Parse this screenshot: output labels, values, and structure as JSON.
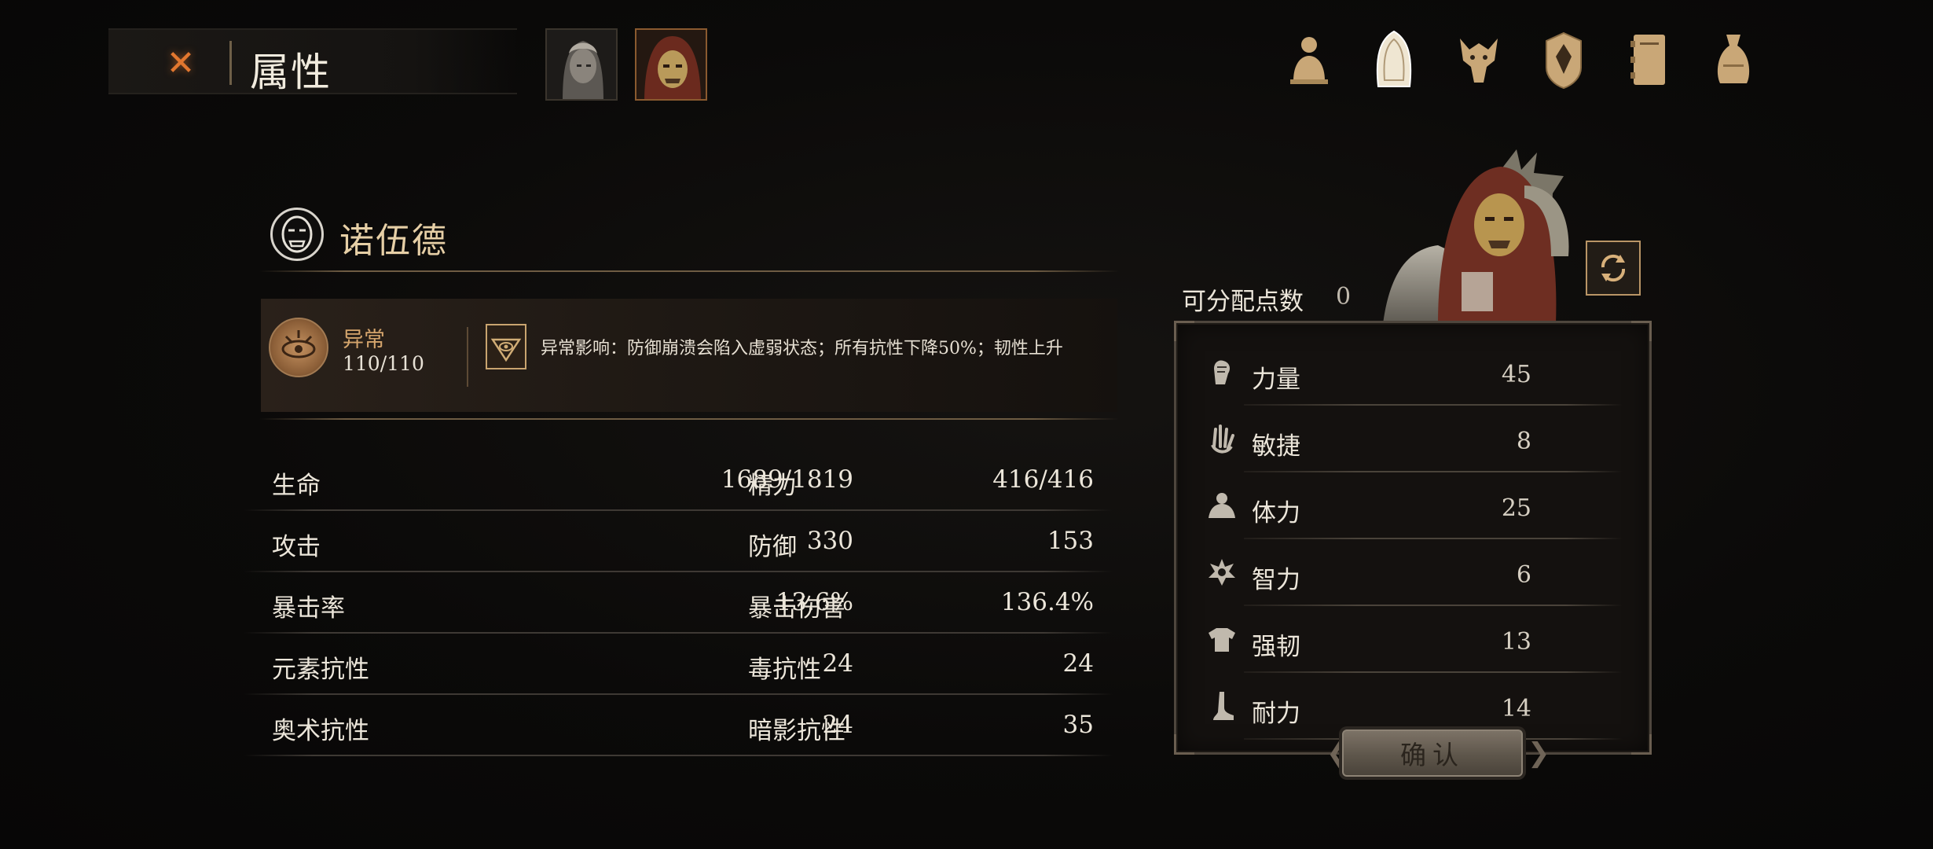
{
  "header": {
    "title": "属性"
  },
  "character": {
    "name": "诺伍德"
  },
  "status": {
    "name": "异常",
    "count": "110/110",
    "description": "异常影响：防御崩溃会陷入虚弱状态；所有抗性下降50%；韧性上升"
  },
  "stats": [
    {
      "left_label": "生命",
      "left_value": "1689/1819",
      "right_label": "精力",
      "right_value": "416/416"
    },
    {
      "left_label": "攻击",
      "left_value": "330",
      "right_label": "防御",
      "right_value": "153"
    },
    {
      "left_label": "暴击率",
      "left_value": "13.6%",
      "right_label": "暴击伤害",
      "right_value": "136.4%"
    },
    {
      "left_label": "元素抗性",
      "left_value": "24",
      "right_label": "毒抗性",
      "right_value": "24"
    },
    {
      "left_label": "奥术抗性",
      "left_value": "24",
      "right_label": "暗影抗性",
      "right_value": "35"
    }
  ],
  "attributes": {
    "points_label": "可分配点数",
    "points_value": "0",
    "items": [
      {
        "label": "力量",
        "value": "45",
        "icon": "strength-icon"
      },
      {
        "label": "敏捷",
        "value": "8",
        "icon": "agility-icon"
      },
      {
        "label": "体力",
        "value": "25",
        "icon": "stamina-icon"
      },
      {
        "label": "智力",
        "value": "6",
        "icon": "intelligence-icon"
      },
      {
        "label": "强韧",
        "value": "13",
        "icon": "toughness-icon"
      },
      {
        "label": "耐力",
        "value": "14",
        "icon": "endurance-icon"
      }
    ],
    "confirm_label": "确认"
  },
  "colors": {
    "accent_gold": "#d4a46c",
    "close_orange": "#e2772f",
    "name_gold": "#e6cfa6"
  }
}
